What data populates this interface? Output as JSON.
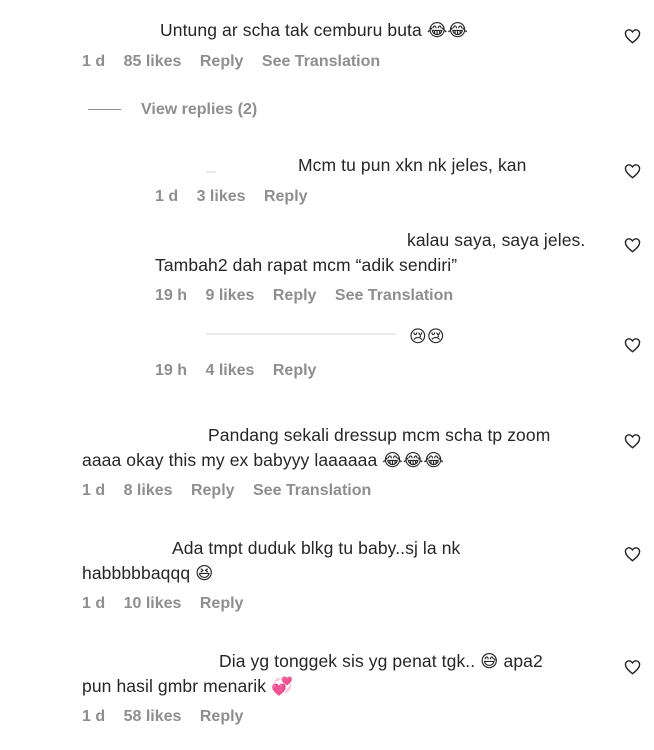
{
  "comments": [
    {
      "text": "Untung ar scha tak cemburu buta 😂😂",
      "time": "1 d",
      "likes": "85 likes",
      "reply": "Reply",
      "translate": "See Translation"
    },
    {
      "view_replies": "View replies (2)"
    },
    {
      "text": "Mcm tu pun xkn nk jeles, kan",
      "time": "1 d",
      "likes": "3 likes",
      "reply": "Reply"
    },
    {
      "text_line1": "kalau saya, saya jeles.",
      "text_line2": "Tambah2 dah rapat mcm “adik sendiri”",
      "time": "19 h",
      "likes": "9 likes",
      "reply": "Reply",
      "translate": "See Translation"
    },
    {
      "text": "😢😢",
      "time": "19 h",
      "likes": "4 likes",
      "reply": "Reply"
    },
    {
      "text_line1": "Pandang sekali dressup mcm scha tp zoom",
      "text_line2": "aaaa okay this my ex babyyy laaaaaa 😂😂😂",
      "time": "1 d",
      "likes": "8 likes",
      "reply": "Reply",
      "translate": "See Translation"
    },
    {
      "text_line1": "Ada tmpt duduk blkg tu baby..sj la nk",
      "text_line2": "habbbbbaqqq 😆",
      "time": "1 d",
      "likes": "10 likes",
      "reply": "Reply"
    },
    {
      "text_line1": "Dia yg tonggek sis yg penat tgk.. 😅 apa2",
      "text_line2": "pun hasil gmbr menarik 💞",
      "time": "1 d",
      "likes": "58 likes",
      "reply": "Reply"
    }
  ],
  "icons": {
    "like": "heart-outline-icon"
  }
}
